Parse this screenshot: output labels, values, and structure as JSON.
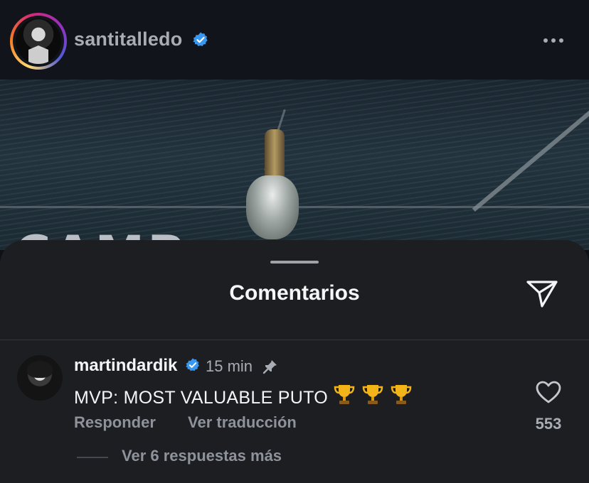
{
  "post": {
    "username": "santitalledo",
    "verified": true,
    "more_icon": "more-horizontal-icon",
    "image_text": "CAMP"
  },
  "comments_sheet": {
    "title": "Comentarios",
    "share_icon": "send-icon"
  },
  "comment": {
    "username": "martindardik",
    "verified": true,
    "time": "15 min",
    "pinned": true,
    "text": "MVP: MOST VALUABLE PUTO",
    "emoji": [
      "trophy-icon",
      "trophy-icon",
      "trophy-icon"
    ],
    "reply_label": "Responder",
    "translate_label": "Ver traducción",
    "like_count": "553",
    "replies_label": "Ver 6 respuestas más"
  },
  "colors": {
    "background": "#0d1116",
    "sheet": "#1c1e22",
    "verified_badge": "#3897f0",
    "secondary_text": "#8e929a"
  }
}
